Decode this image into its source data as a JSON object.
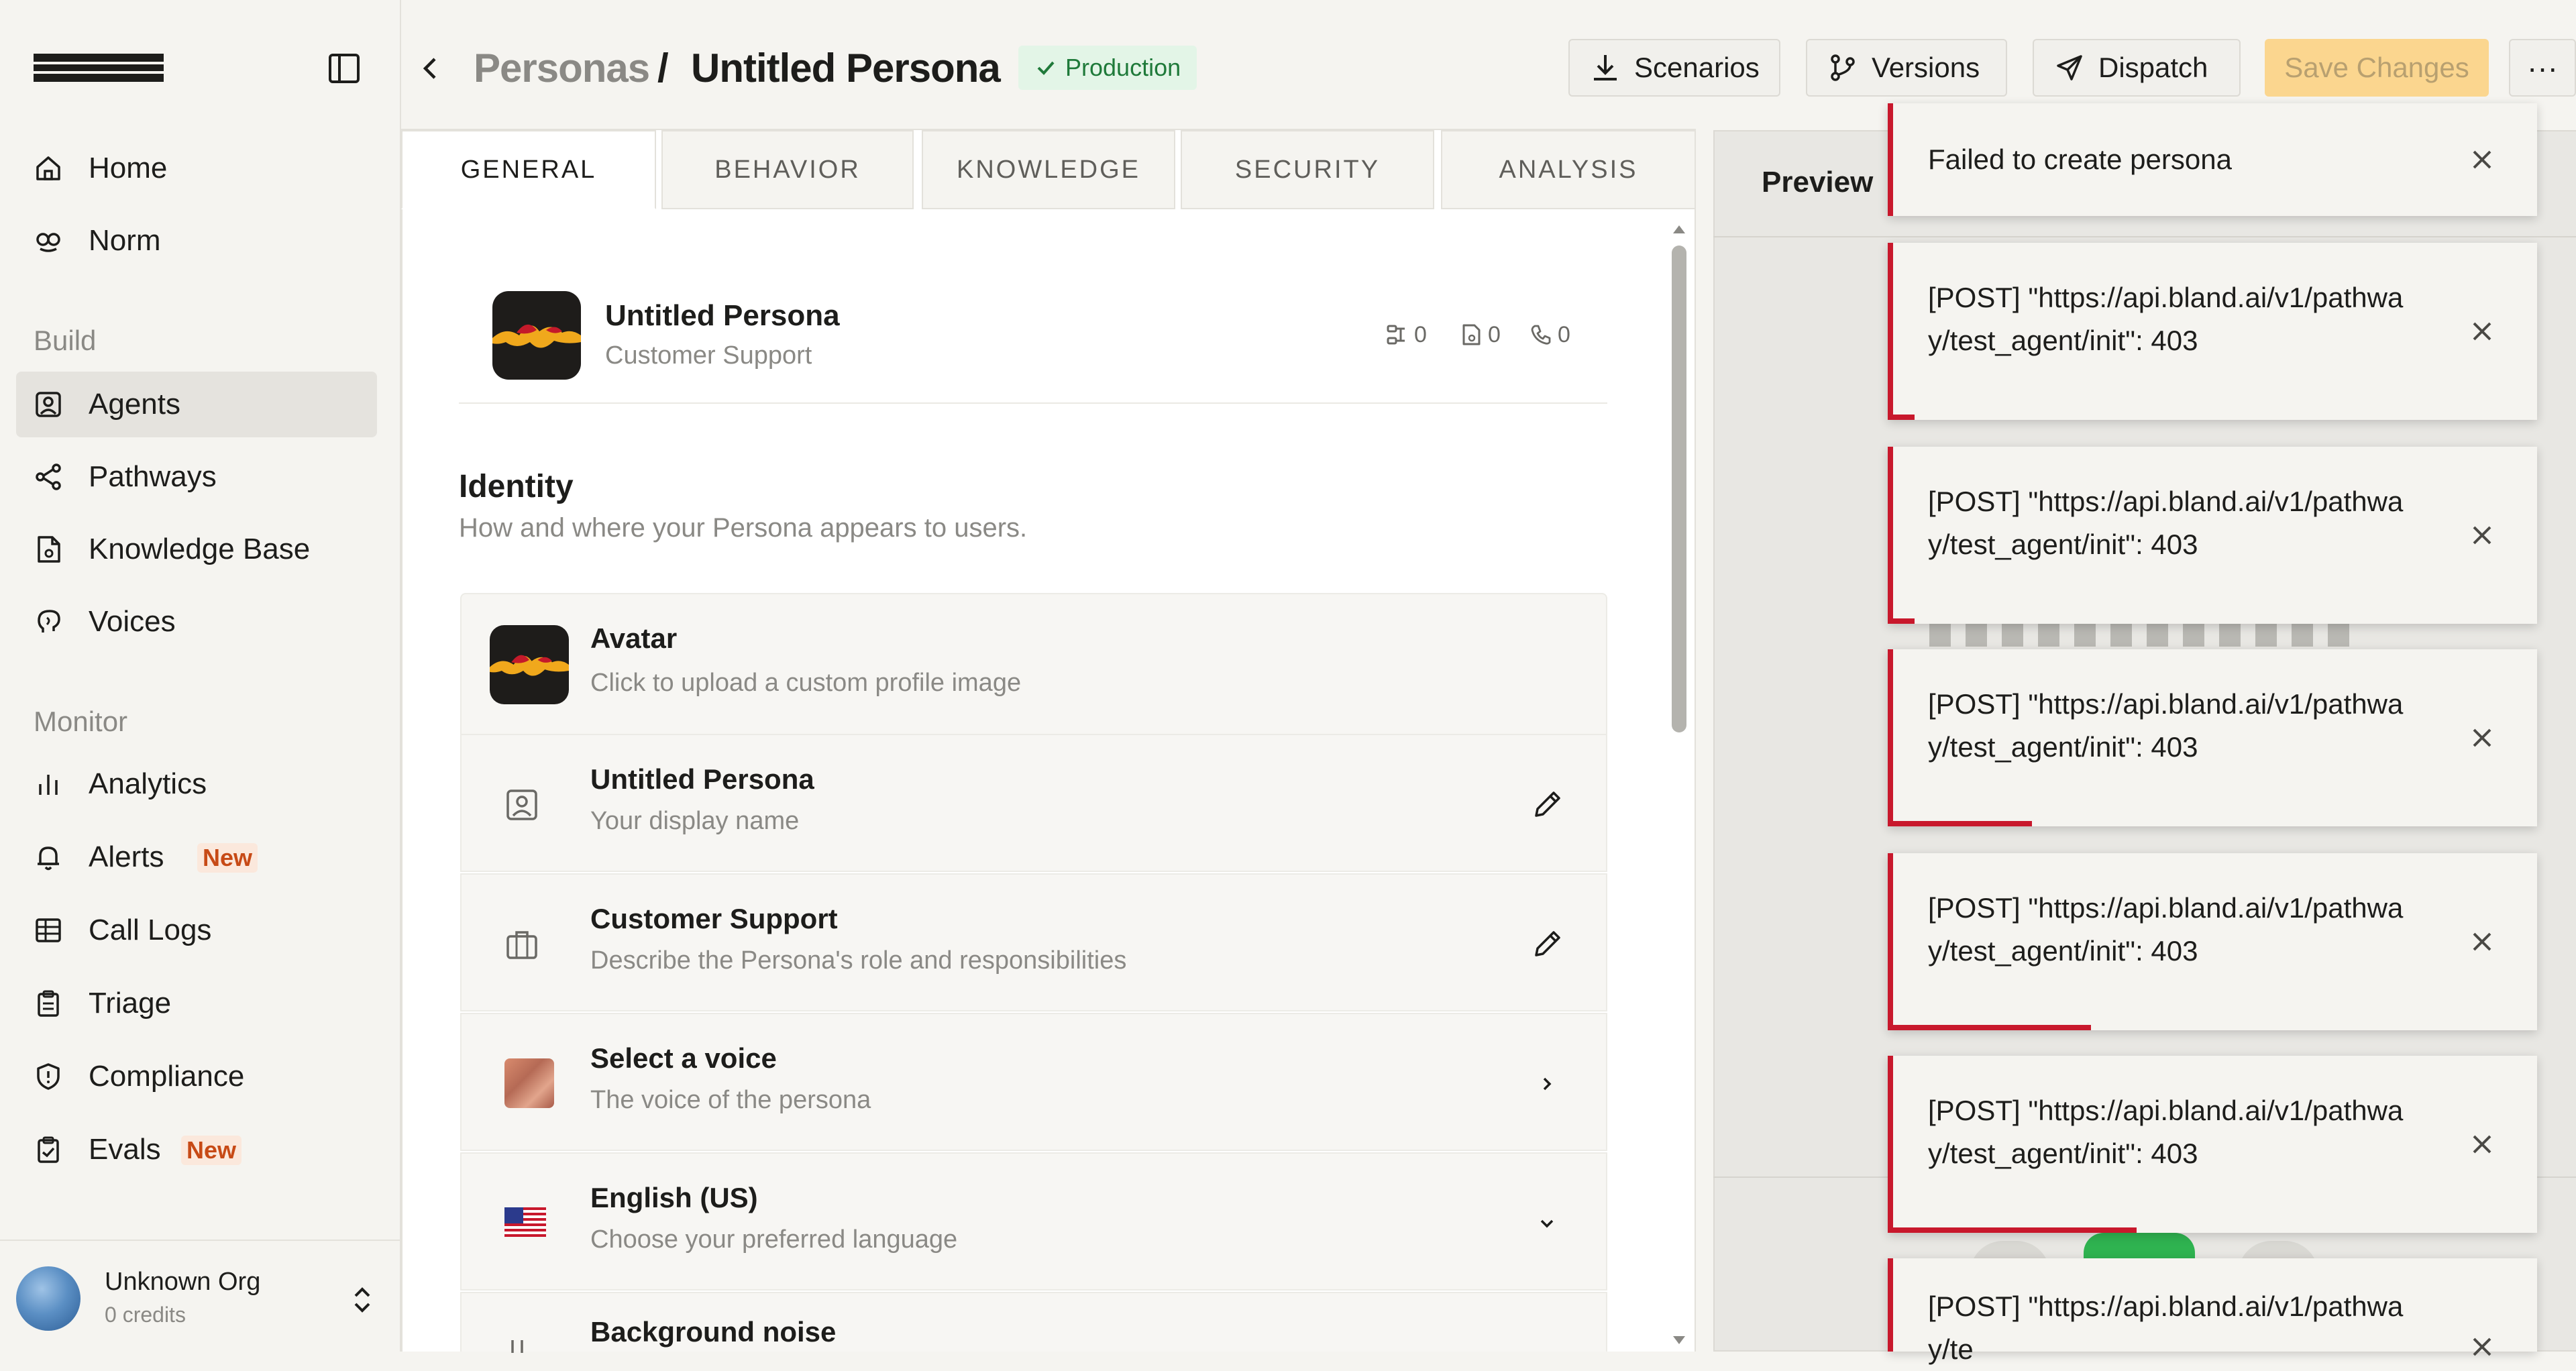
{
  "sidebar": {
    "logo_text": "bland",
    "items_top": [
      {
        "label": "Home",
        "icon": "home-icon"
      },
      {
        "label": "Norm",
        "icon": "norm-icon"
      }
    ],
    "section_build": "Build",
    "items_build": [
      {
        "label": "Agents",
        "icon": "agents-icon",
        "active": true
      },
      {
        "label": "Pathways",
        "icon": "pathways-icon"
      },
      {
        "label": "Knowledge Base",
        "icon": "knowledge-base-icon"
      },
      {
        "label": "Voices",
        "icon": "voices-icon"
      }
    ],
    "section_monitor": "Monitor",
    "items_monitor": [
      {
        "label": "Analytics",
        "icon": "analytics-icon"
      },
      {
        "label": "Alerts",
        "icon": "bell-icon",
        "badge": "New"
      },
      {
        "label": "Call Logs",
        "icon": "table-icon"
      },
      {
        "label": "Triage",
        "icon": "clipboard-icon"
      },
      {
        "label": "Compliance",
        "icon": "shield-icon"
      },
      {
        "label": "Evals",
        "icon": "clipboard-check-icon",
        "badge": "New"
      }
    ],
    "org": {
      "name": "Unknown Org",
      "credits": "0 credits"
    }
  },
  "header": {
    "breadcrumb_parent": "Personas",
    "separator": "/",
    "breadcrumb_current": "Untitled Persona",
    "status_badge": "Production",
    "buttons": {
      "scenarios": "Scenarios",
      "versions": "Versions",
      "dispatch": "Dispatch",
      "save": "Save Changes",
      "more": "···"
    }
  },
  "tabs": [
    "GENERAL",
    "BEHAVIOR",
    "KNOWLEDGE",
    "SECURITY",
    "ANALYSIS"
  ],
  "active_tab": "GENERAL",
  "persona_header": {
    "name": "Untitled Persona",
    "role": "Customer Support",
    "stats": {
      "pathways": "0",
      "documents": "0",
      "calls": "0"
    }
  },
  "identity": {
    "title": "Identity",
    "subtitle": "How and where your Persona appears to users.",
    "rows": [
      {
        "title": "Avatar",
        "subtitle": "Click to upload a custom profile image"
      },
      {
        "title": "Untitled Persona",
        "subtitle": "Your display name"
      },
      {
        "title": "Customer Support",
        "subtitle": "Describe the Persona's role and responsibilities"
      },
      {
        "title": "Select a voice",
        "subtitle": "The voice of the persona"
      },
      {
        "title": "English (US)",
        "subtitle": "Choose your preferred language"
      },
      {
        "title": "Background noise",
        "subtitle": ""
      }
    ]
  },
  "preview": {
    "title": "Preview"
  },
  "toasts": [
    {
      "message": "Failed to create persona"
    },
    {
      "message": "[POST] \"https://api.bland.ai/v1/pathway/test_agent/init\": 403",
      "progress": 0.02
    },
    {
      "message": "[POST] \"https://api.bland.ai/v1/pathway/test_agent/init\": 403",
      "progress": 0.04
    },
    {
      "message": "[POST] \"https://api.bland.ai/v1/pathway/test_agent/init\": 403",
      "progress": 0.22
    },
    {
      "message": "[POST] \"https://api.bland.ai/v1/pathway/test_agent/init\": 403",
      "progress": 0.31
    },
    {
      "message": "[POST] \"https://api.bland.ai/v1/pathway/test_agent/init\": 403",
      "progress": 0.38
    },
    {
      "message": "[POST] \"https://api.bland.ai/v1/pathway/te",
      "progress": 0.0
    }
  ],
  "colors": {
    "accent_save": "#fbd68f",
    "error_red": "#c8182c",
    "production_green": "#1f7a3a",
    "badge_new": "#c74a16"
  }
}
